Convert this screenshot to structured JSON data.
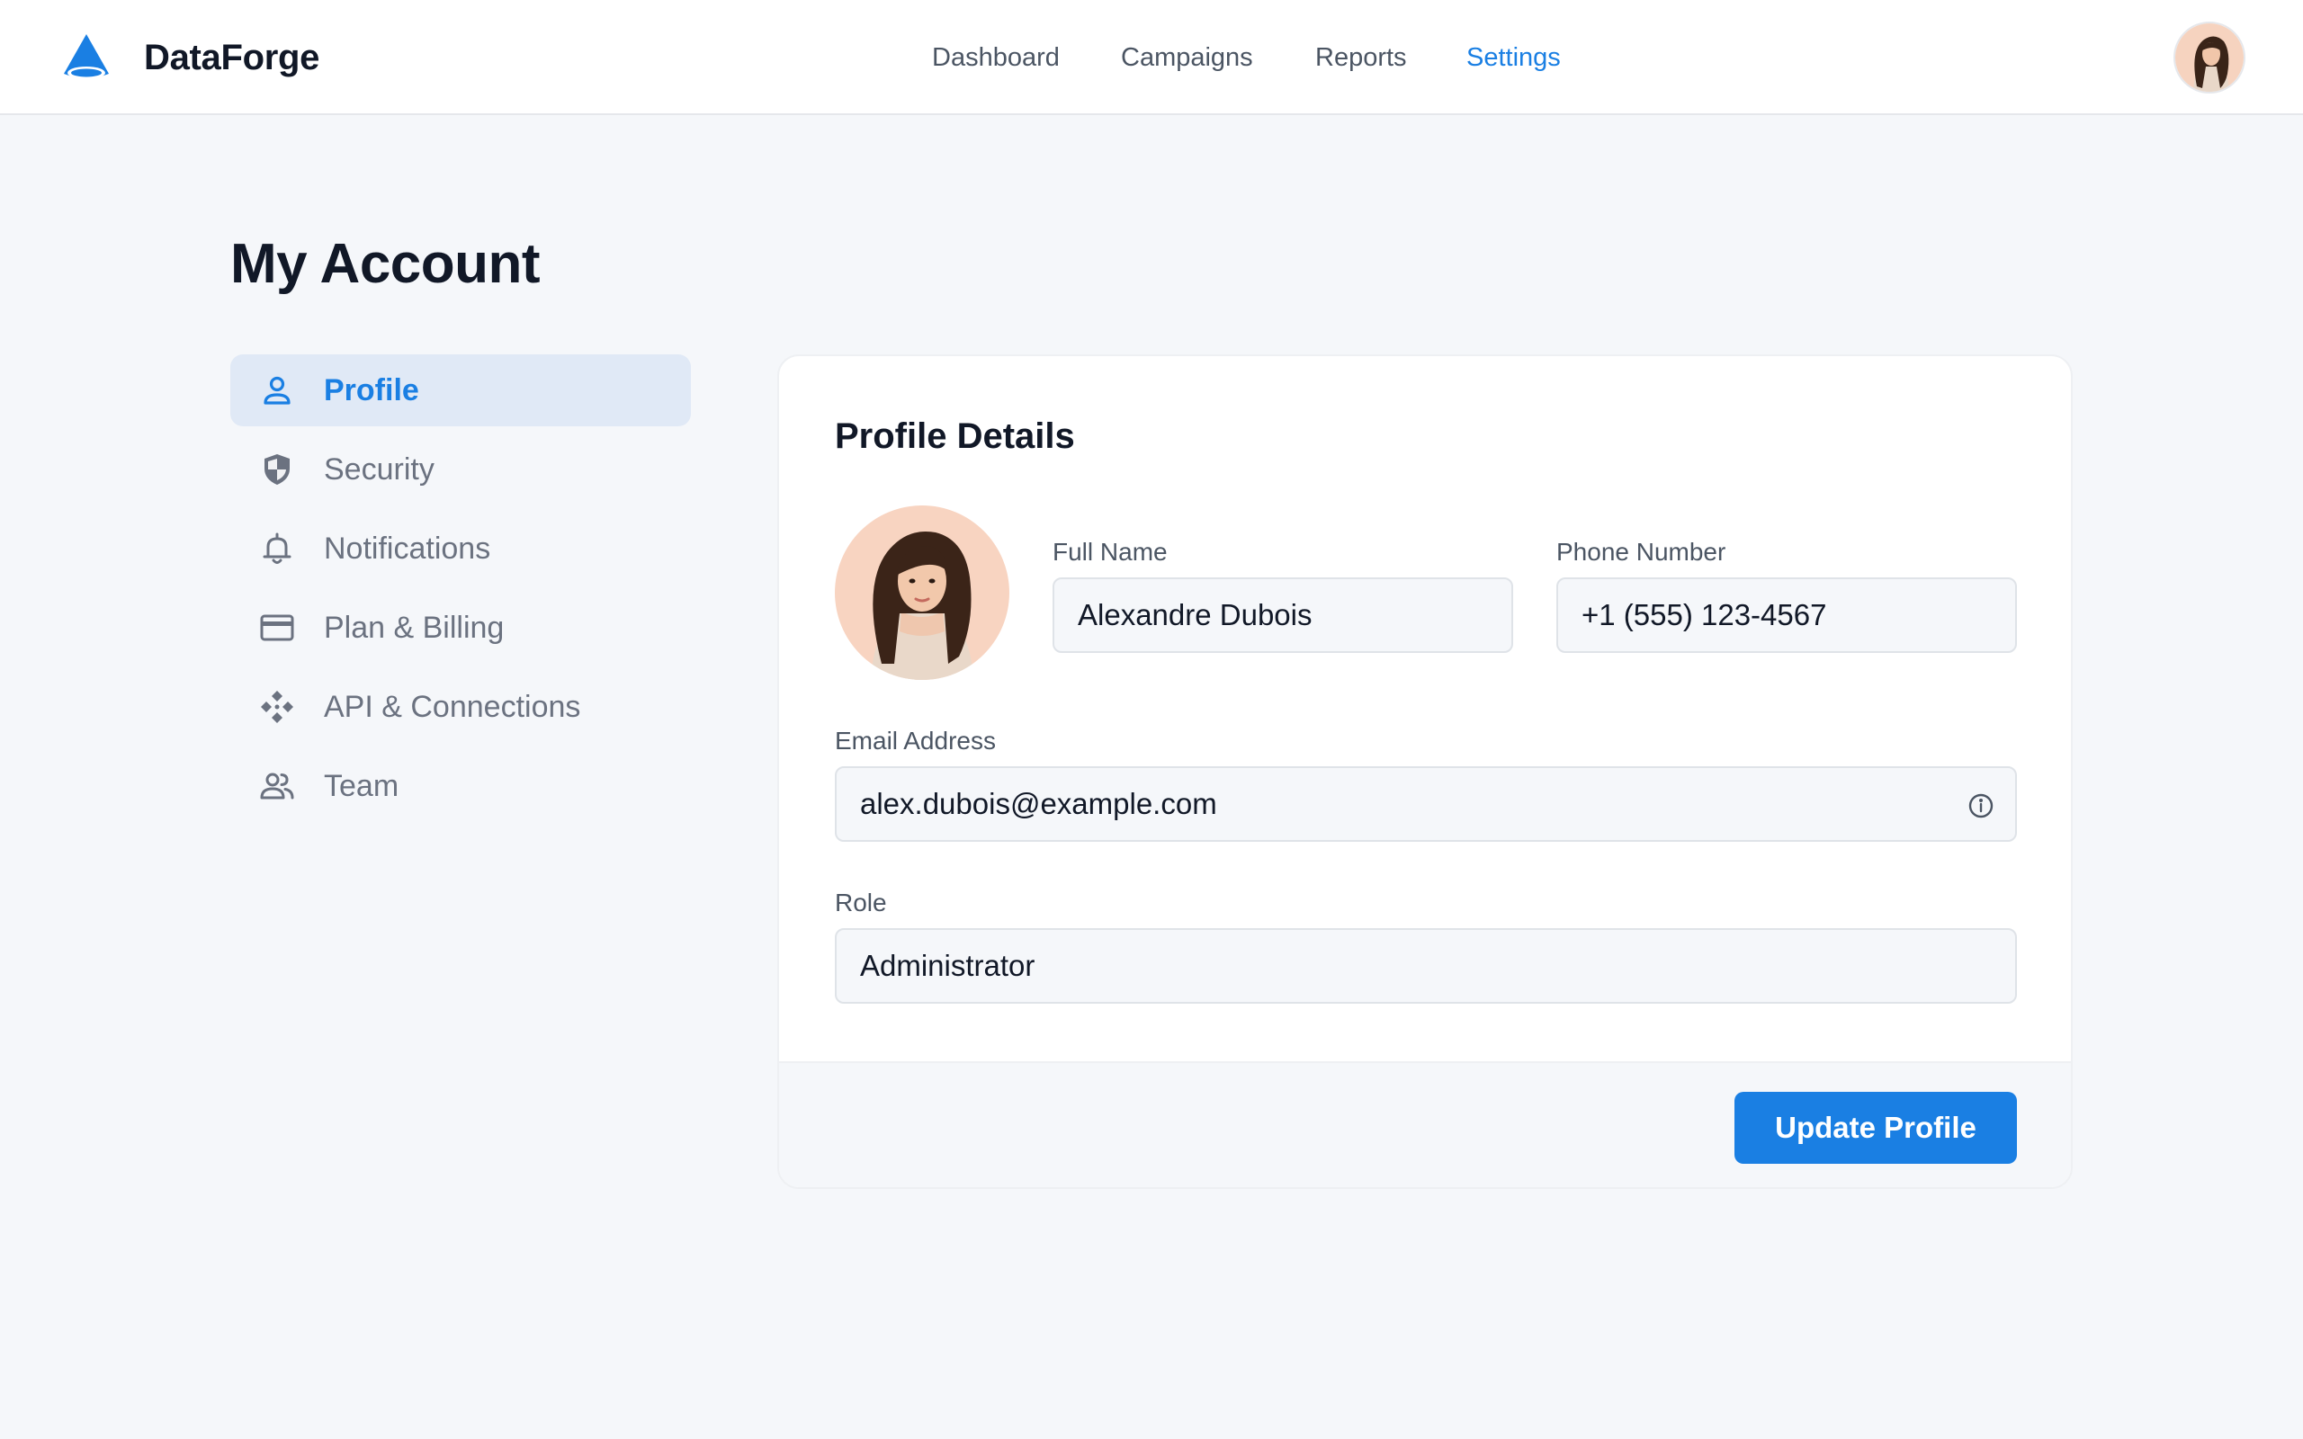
{
  "app": {
    "brand": "DataForge",
    "accent_color": "#1a7fe3",
    "logo_icon": "cone-logo-icon"
  },
  "nav": {
    "items": [
      {
        "label": "Dashboard",
        "active": false
      },
      {
        "label": "Campaigns",
        "active": false
      },
      {
        "label": "Reports",
        "active": false
      },
      {
        "label": "Settings",
        "active": true
      }
    ]
  },
  "page": {
    "title": "My Account"
  },
  "sidebar": {
    "items": [
      {
        "label": "Profile",
        "icon": "user-icon",
        "active": true
      },
      {
        "label": "Security",
        "icon": "shield-icon",
        "active": false
      },
      {
        "label": "Notifications",
        "icon": "bell-icon",
        "active": false
      },
      {
        "label": "Plan & Billing",
        "icon": "credit-card-icon",
        "active": false
      },
      {
        "label": "API & Connections",
        "icon": "api-connections-icon",
        "active": false
      },
      {
        "label": "Team",
        "icon": "team-icon",
        "active": false
      }
    ]
  },
  "profile": {
    "title": "Profile Details",
    "full_name": {
      "label": "Full Name",
      "value": "Alexandre Dubois"
    },
    "phone": {
      "label": "Phone Number",
      "value": "+1 (555) 123-4567"
    },
    "email": {
      "label": "Email Address",
      "value": "alex.dubois@example.com",
      "icon": "info-icon"
    },
    "role": {
      "label": "Role",
      "value": "Administrator"
    },
    "submit_label": "Update Profile"
  }
}
